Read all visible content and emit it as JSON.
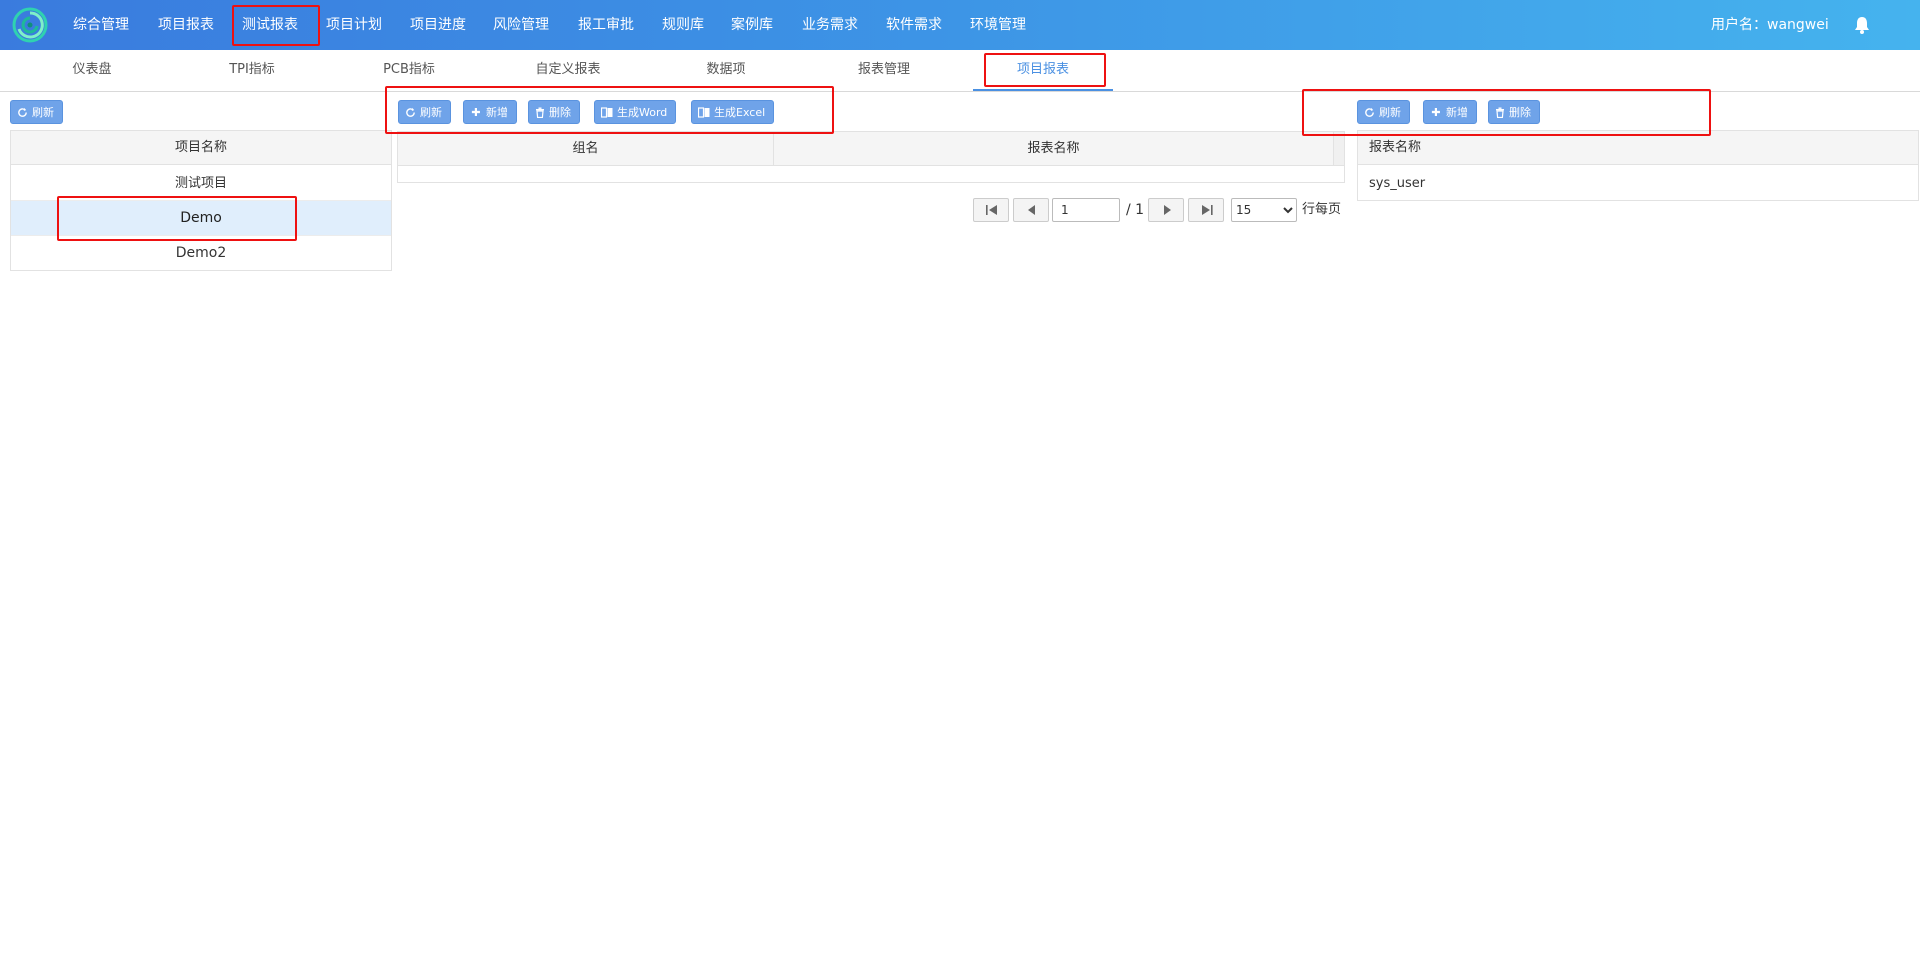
{
  "nav": {
    "items": [
      "综合管理",
      "项目报表",
      "测试报表",
      "项目计划",
      "项目进度",
      "风险管理",
      "报工审批",
      "规则库",
      "案例库",
      "业务需求",
      "软件需求",
      "环境管理"
    ],
    "user": "用户名：wangwei"
  },
  "subtabs": {
    "items": [
      "仪表盘",
      "TPI指标",
      "PCB指标",
      "自定义报表",
      "数据项",
      "报表管理",
      "项目报表"
    ],
    "active_index": 6
  },
  "left_panel": {
    "refresh_label": "刷新",
    "column": "项目名称",
    "rows": [
      "测试项目",
      "Demo",
      "Demo2"
    ],
    "selected_index": 1
  },
  "middle_panel": {
    "buttons": {
      "refresh": "刷新",
      "add": "新增",
      "delete": "删除",
      "word": "生成Word",
      "excel": "生成Excel"
    },
    "columns": [
      "组名",
      "报表名称"
    ],
    "pager": {
      "page": "1",
      "total": "/ 1",
      "page_size": "15",
      "page_size_options": [
        "15"
      ],
      "suffix": "行每页"
    }
  },
  "right_panel": {
    "buttons": {
      "refresh": "刷新",
      "add": "新增",
      "delete": "删除"
    },
    "column": "报表名称",
    "rows": [
      "sys_user"
    ]
  },
  "colors": {
    "nav_gradient_start": "#3a7bde",
    "nav_gradient_end": "#45b3ee",
    "button": "#6fa3e9",
    "active_tab": "#4a90e2",
    "selected_row": "#e0eefc",
    "highlight": "#ee1111"
  }
}
